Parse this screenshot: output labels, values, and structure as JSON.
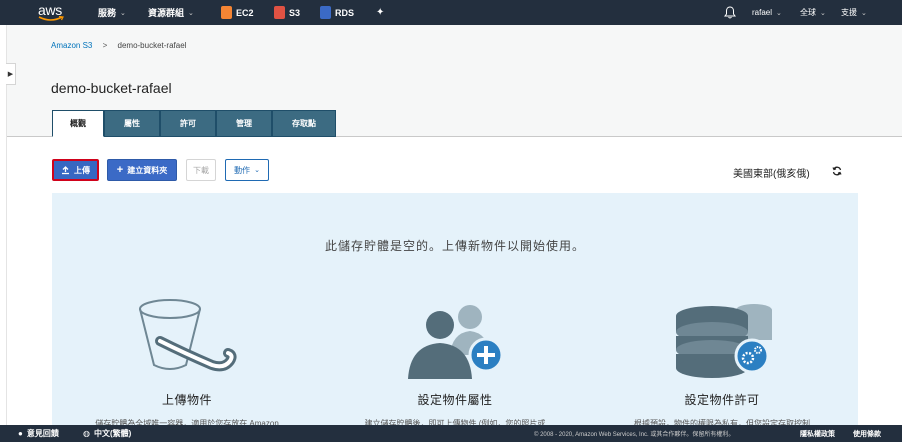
{
  "topnav": {
    "logo": "aws",
    "services": "服務",
    "resource_groups": "資源群組",
    "shortcuts": [
      {
        "label": "EC2",
        "icon": "ec2-icon"
      },
      {
        "label": "S3",
        "icon": "s3-icon"
      },
      {
        "label": "RDS",
        "icon": "rds-icon"
      }
    ],
    "user": "rafael",
    "region_menu": "全球",
    "support": "支援"
  },
  "breadcrumb": {
    "root": "Amazon S3",
    "separator": ">",
    "current": "demo-bucket-rafael"
  },
  "page_title": "demo-bucket-rafael",
  "tabs": [
    {
      "label": "概觀",
      "active": true
    },
    {
      "label": "屬性",
      "active": false
    },
    {
      "label": "許可",
      "active": false
    },
    {
      "label": "管理",
      "active": false
    },
    {
      "label": "存取點",
      "active": false
    }
  ],
  "toolbar": {
    "upload": "上傳",
    "create_folder": "建立資料夾",
    "download": "下載",
    "actions": "動作"
  },
  "region": "美國東部(俄亥俄)",
  "empty_state": {
    "message": "此儲存貯體是空的。上傳新物件以開始使用。",
    "cards": [
      {
        "title": "上傳物件",
        "desc": "儲存貯體為全域唯一容器，適用於您存放在 Amazon",
        "icon": "bucket-icon"
      },
      {
        "title": "設定物件屬性",
        "desc": "建立儲存貯體後，即可上傳物件 (例如，您的照片或",
        "icon": "user-settings-icon"
      },
      {
        "title": "設定物件許可",
        "desc": "根據預設，物件的權限為私有，但您設定存取控制",
        "icon": "database-settings-icon"
      }
    ]
  },
  "footer": {
    "feedback": "意見回饋",
    "language": "中文(繁體)",
    "copyright": "© 2008 - 2020, Amazon Web Services, Inc. 或其合作夥伴。保留所有權利。",
    "privacy": "隱私權政策",
    "terms": "使用條款"
  },
  "colors": {
    "nav_bg": "#232f3e",
    "primary_button": "#3b6ac6",
    "tab_bg": "#3c6b82",
    "empty_panel_bg": "#e5f2fa",
    "upload_highlight": "#d0021b"
  }
}
